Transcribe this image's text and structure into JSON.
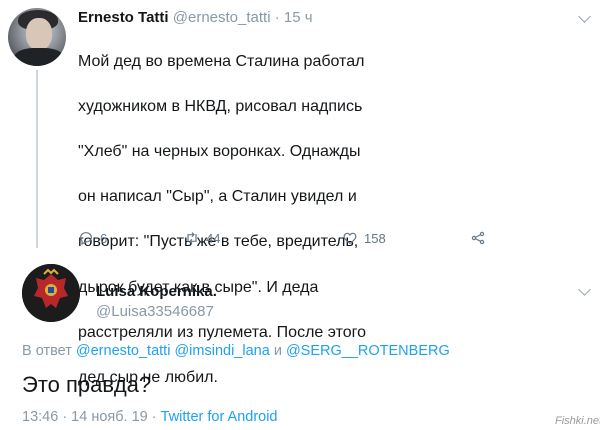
{
  "tweet1": {
    "name": "Ernesto Tatti",
    "handle": "@ernesto_tatti",
    "separator": "·",
    "time": "15 ч",
    "text_lines": [
      "Мой дед во времена Сталина работал",
      "художником в НКВД, рисовал надпись",
      "\"Хлеб\" на черных воронках. Однажды",
      "он написал \"Сыр\", а Сталин увидел и",
      "говорит: \"Пусть же в тебе, вредитель,",
      "дырок будет как в сыре\". И деда",
      "расстреляли из пулемета. После этого",
      "дед сыр не любил."
    ],
    "replies": "6",
    "retweets": "44",
    "likes": "158"
  },
  "tweet2": {
    "name": "Luisa Kopernika.",
    "handle": "@Luisa33546687",
    "reply_prefix": "В ответ",
    "mentions": [
      "@ernesto_tatti",
      "@imsindi_lana",
      "@SERG__ROTENBERG"
    ],
    "mention_joiner": "и",
    "text": "Это правда?",
    "timestamp": "13:46 · 14 нояб. 19 ·",
    "source": "Twitter for Android"
  },
  "watermark": "Fishki.net",
  "colors": {
    "text": "#14171a",
    "muted": "#8899a6",
    "link": "#1da1f2",
    "divider": "#ccd6dd"
  },
  "icons": [
    "chevron-down-icon",
    "reply-icon",
    "retweet-icon",
    "like-icon",
    "share-icon"
  ]
}
